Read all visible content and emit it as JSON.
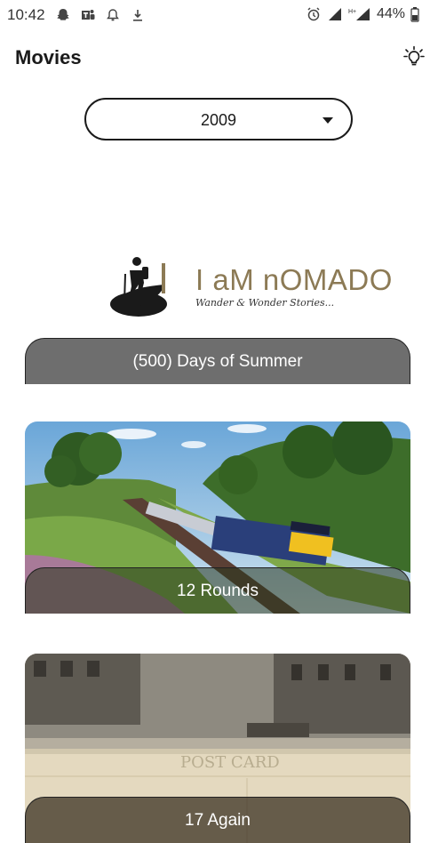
{
  "status_bar": {
    "time": "10:42",
    "battery": "44%"
  },
  "header": {
    "title": "Movies",
    "theme_icon": "lightbulb-icon"
  },
  "year_select": {
    "value": "2009"
  },
  "movies": [
    {
      "title": "(500) Days of Summer",
      "image": "logo-i-am-nomado"
    },
    {
      "title": "12 Rounds",
      "image": "train-landscape-photo"
    },
    {
      "title": "17 Again",
      "image": "vintage-postcard-street"
    }
  ],
  "logo": {
    "name": "I aM nOMADO",
    "tagline": "Wander & Wonder Stories..."
  },
  "colors": {
    "label_gray": "#6e6e6e",
    "logo_text": "#8c7a55"
  }
}
